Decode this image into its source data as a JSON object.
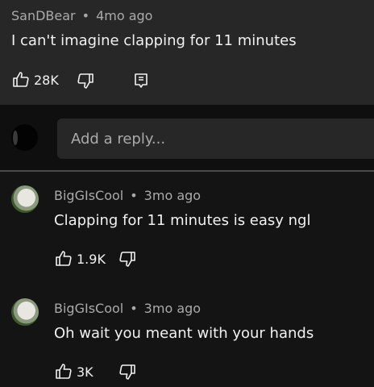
{
  "parent_comment": {
    "author": "SanDBear",
    "time": "4mo ago",
    "separator": "•",
    "text": "I can't imagine clapping for 11 minutes",
    "likes": "28K"
  },
  "reply_box": {
    "placeholder": "Add a reply..."
  },
  "replies": [
    {
      "author": "BigGIsCool",
      "separator": "•",
      "time": "3mo ago",
      "text": "Clapping for 11 minutes is easy ngl",
      "likes": "1.9K"
    },
    {
      "author": "BigGIsCool",
      "separator": "•",
      "time": "3mo ago",
      "text": "Oh wait you meant with your hands",
      "likes": "3K"
    }
  ],
  "icons": {
    "like": "thumbs-up-icon",
    "dislike": "thumbs-down-icon",
    "reply": "comment-reply-icon"
  },
  "colors": {
    "background": "#141414",
    "card": "#272727",
    "text": "#f1f1f1",
    "muted": "#aaaaaa"
  }
}
